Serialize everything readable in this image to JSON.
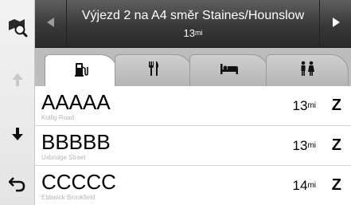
{
  "header": {
    "title": "Výjezd 2 na A4 směr Staines/Hounslow",
    "distance": "13",
    "distance_unit": "mi"
  },
  "sidebar": {
    "items": [
      {
        "icon": "map-search-icon"
      },
      {
        "icon": "scroll-up-icon"
      },
      {
        "icon": "scroll-down-icon"
      },
      {
        "icon": "back-icon"
      }
    ]
  },
  "tabs": [
    {
      "icon": "fuel-pump-icon",
      "active": true
    },
    {
      "icon": "restaurant-icon",
      "active": false
    },
    {
      "icon": "lodging-icon",
      "active": false
    },
    {
      "icon": "restroom-icon",
      "active": false
    }
  ],
  "results": [
    {
      "name": "AAAAA",
      "address": "Kollig Road",
      "distance": "13",
      "unit": "mi",
      "direction": "Z"
    },
    {
      "name": "BBBBB",
      "address": "Uxbridge Street",
      "distance": "13",
      "unit": "mi",
      "direction": "Z"
    },
    {
      "name": "CCCCC",
      "address": "Ebbwick Brookfield",
      "distance": "14",
      "unit": "mi",
      "direction": "Z"
    }
  ],
  "colors": {
    "header_bg": "#383838",
    "accent": "#0a0a0a"
  }
}
